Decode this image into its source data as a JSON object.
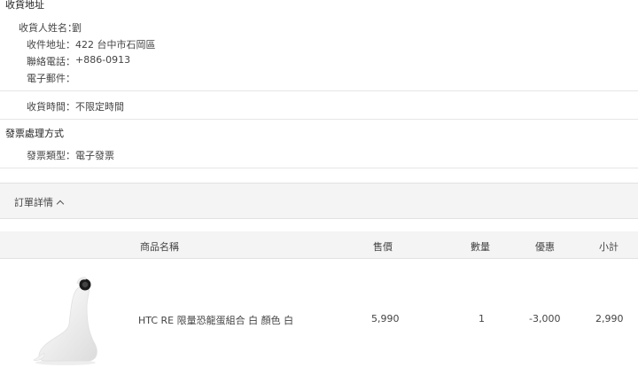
{
  "shipping": {
    "title": "收貨地址",
    "recipient_label": "收貨人姓名：",
    "recipient_value": "劉",
    "address_label": "收件地址：",
    "address_value": "422 台中市石岡區",
    "phone_label": "聯絡電話：",
    "phone_value": "+886-0913",
    "email_label": "電子郵件：",
    "email_value": "",
    "delivery_time_label": "收貨時間：",
    "delivery_time_value": "不限定時間"
  },
  "invoice": {
    "title": "發票處理方式",
    "type_label": "發票類型：",
    "type_value": "電子發票"
  },
  "order_details": {
    "toggle_label": "訂單詳情",
    "toggle_icon": "chevron-up-icon"
  },
  "table": {
    "headers": {
      "name": "商品名稱",
      "price": "售價",
      "qty": "數量",
      "discount": "優惠",
      "subtotal": "小計"
    },
    "rows": [
      {
        "image": "white-dinosaur-speaker",
        "name": "HTC RE 限量恐龍蛋組合 白 顏色 白",
        "price": "5,990",
        "qty": "1",
        "discount": "-3,000",
        "subtotal": "2,990"
      }
    ]
  }
}
